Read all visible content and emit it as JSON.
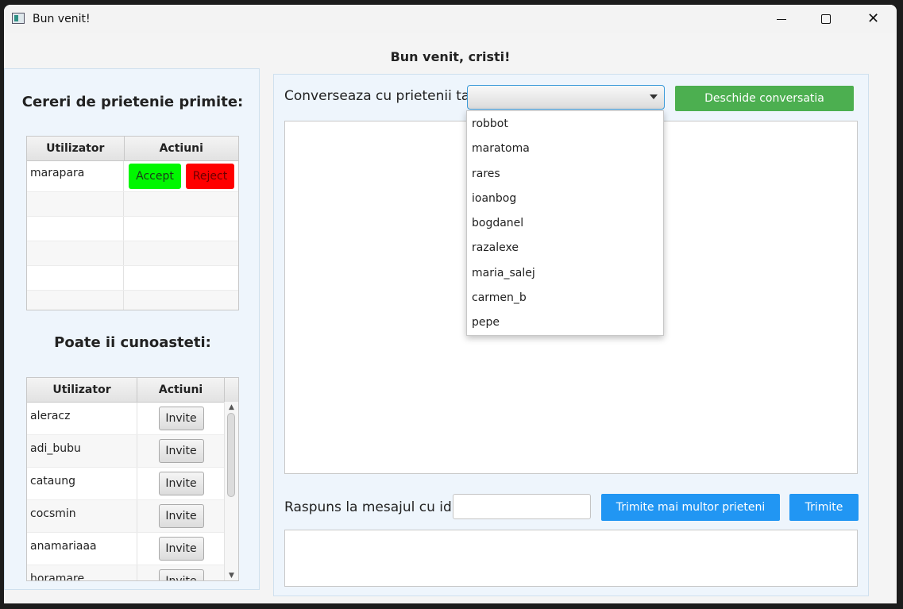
{
  "window": {
    "title": "Bun venit!",
    "controls": {
      "minimize": "minimize",
      "maximize": "maximize",
      "close": "close"
    }
  },
  "welcome_text": "Bun venit, cristi!",
  "friend_requests": {
    "title": "Cereri de prietenie primite:",
    "columns": [
      "Utilizator",
      "Actiuni"
    ],
    "rows": [
      {
        "user": "marapara",
        "accept_label": "Accept",
        "reject_label": "Reject"
      }
    ]
  },
  "suggestions": {
    "title": "Poate ii cunoasteti:",
    "columns": [
      "Utilizator",
      "Actiuni"
    ],
    "rows": [
      {
        "user": "aleracz",
        "action": "Invite"
      },
      {
        "user": "adi_bubu",
        "action": "Invite"
      },
      {
        "user": "cataung",
        "action": "Invite"
      },
      {
        "user": "cocsmin",
        "action": "Invite"
      },
      {
        "user": "anamariaaa",
        "action": "Invite"
      },
      {
        "user": "horamare",
        "action": "Invite"
      }
    ]
  },
  "chat": {
    "label": "Converseaza cu prietenii tai:",
    "combo_value": "",
    "open_button": "Deschide conversatia",
    "dropdown_options": [
      "robbot",
      "maratoma",
      "rares",
      "ioanbog",
      "bogdanel",
      "razalexe",
      "maria_salej",
      "carmen_b",
      "pepe"
    ],
    "reply_label": "Raspuns la mesajul cu id:",
    "reply_value": "",
    "send_multiple_button": "Trimite mai multor prieteni",
    "send_button": "Trimite",
    "message_value": ""
  },
  "colors": {
    "accept": "#00f700",
    "reject": "#ff0000",
    "open_button": "#4caf50",
    "send_buttons": "#2196f3",
    "panel_bg": "#eef5fc"
  }
}
